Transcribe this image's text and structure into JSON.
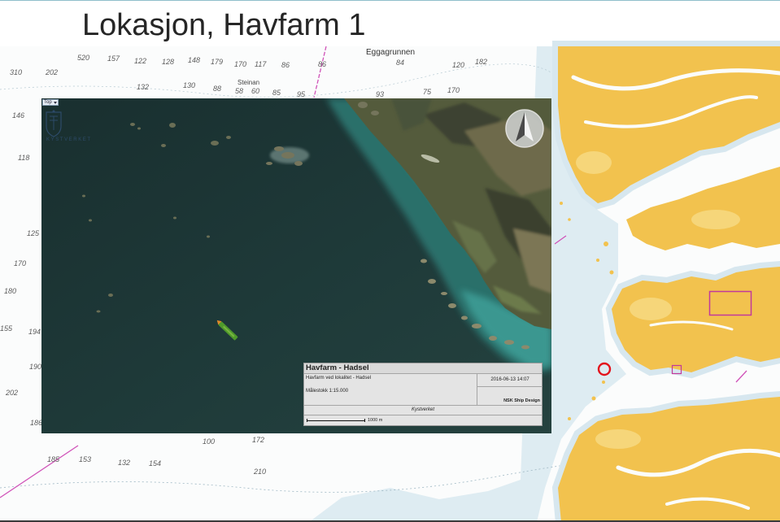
{
  "slide": {
    "title": "Lokasjon, Havfarm 1"
  },
  "chart": {
    "place_names": {
      "eggagrunnen": "Eggagrunnen",
      "steinan": "Steinan"
    },
    "depth_labels": [
      "520",
      "157",
      "122",
      "128",
      "148",
      "179",
      "170",
      "117",
      "86",
      "86",
      "84",
      "120",
      "182",
      "310",
      "202",
      "132",
      "130",
      "88",
      "58",
      "60",
      "85",
      "95",
      "93",
      "75",
      "170",
      "146",
      "118",
      "125",
      "170",
      "180",
      "155",
      "194",
      "190",
      "202",
      "186",
      "185",
      "153",
      "132",
      "154",
      "100",
      "172",
      "210"
    ]
  },
  "inset": {
    "view_button": "Top",
    "view_button_icon": "chevron-down-icon",
    "logo_text": "KYSTVERKET",
    "compass_icon": "north-arrow-icon",
    "info": {
      "title": "Havfarm - Hadsel",
      "description": "Havfarm ved lokalitet - Hadsel",
      "timestamp": "2016-06-13 14:07",
      "scale": "Målestokk 1:15.000",
      "designer": "NSK Ship Design",
      "source": "Kystverket",
      "scale_bar_label": "1000 m"
    }
  },
  "colors": {
    "sea": "#fbfcfc",
    "shallow": "#d7e7ef",
    "land": "#f2c24e",
    "land_light": "#f6d67a",
    "fairway_line": "#d052b8",
    "location_marker": "#e3141d",
    "highlight_box": "#c2399b",
    "satellite_land": "#545b3c",
    "vessel": "#4f9a2b",
    "vessel_bow": "#e08a2a"
  }
}
